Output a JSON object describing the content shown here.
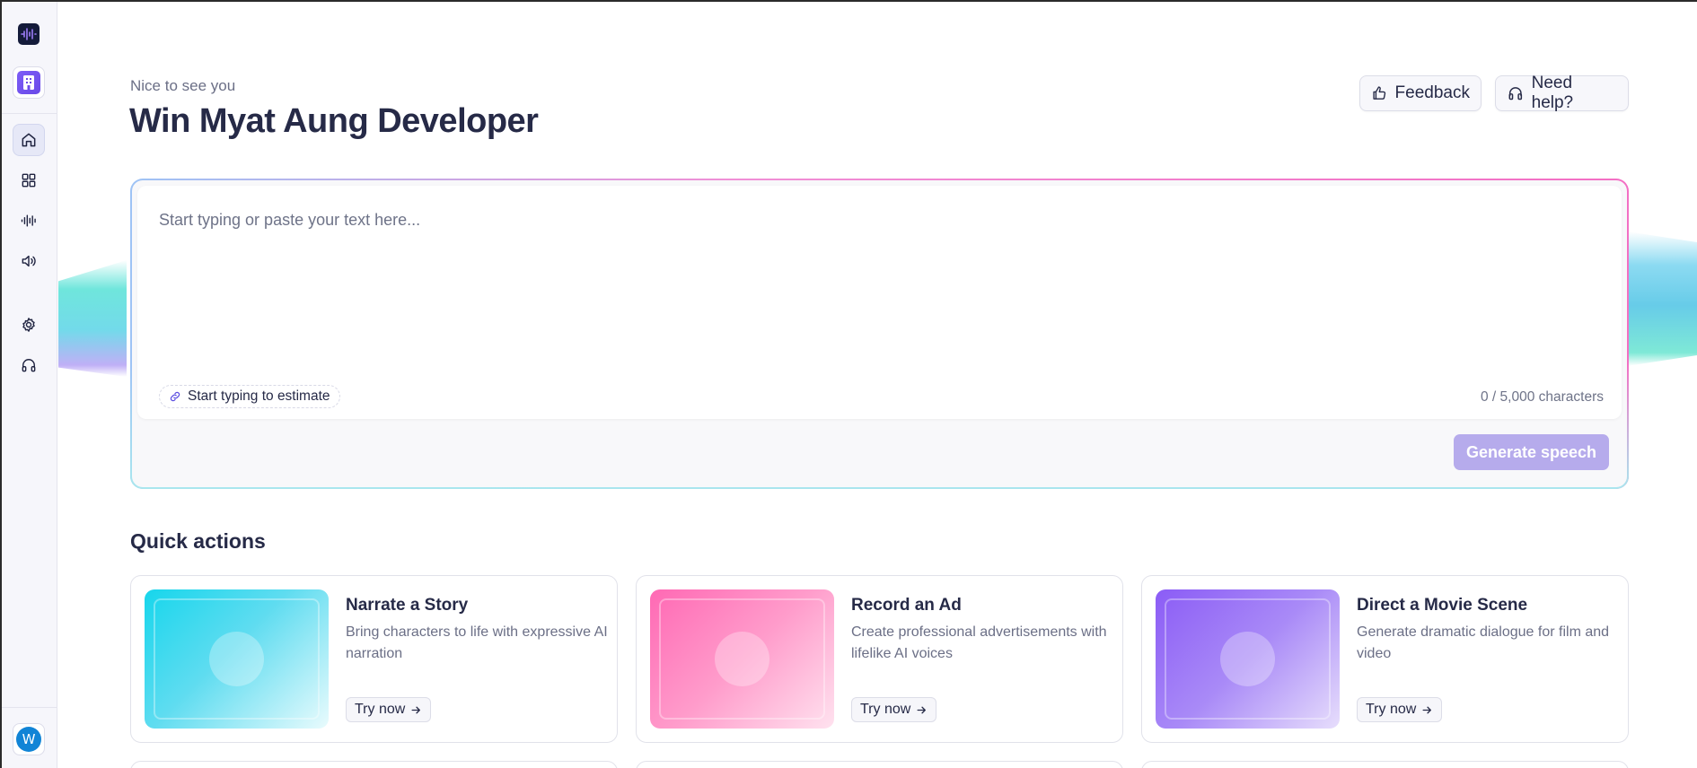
{
  "sidebar": {
    "logo_icon": "waveform-logo-icon",
    "workspace_icon": "building-icon",
    "items": [
      {
        "name": "home",
        "icon": "home-icon"
      },
      {
        "name": "apps",
        "icon": "grid-icon"
      },
      {
        "name": "voices",
        "icon": "waveform-icon"
      },
      {
        "name": "sound",
        "icon": "speaker-icon"
      },
      {
        "name": "settings",
        "icon": "gear-icon"
      },
      {
        "name": "support",
        "icon": "headphones-icon"
      }
    ],
    "avatar_initial": "W"
  },
  "header": {
    "greeting": "Nice to see you",
    "title": "Win Myat Aung Developer",
    "feedback_label": "Feedback",
    "help_label": "Need help?"
  },
  "editor": {
    "placeholder": "Start typing or paste your text here...",
    "estimate_label": "Start typing to estimate",
    "char_count": "0 / 5,000 characters",
    "generate_label": "Generate speech"
  },
  "quick_actions": {
    "title": "Quick actions",
    "cards": [
      {
        "name": "Narrate a Story",
        "desc": "Bring characters to life with expressive AI narration",
        "cta": "Try now",
        "color": "#17d6ec"
      },
      {
        "name": "Record an Ad",
        "desc": "Create professional advertisements with lifelike AI voices",
        "cta": "Try now",
        "color": "#ff69b4"
      },
      {
        "name": "Direct a Movie Scene",
        "desc": "Generate dramatic dialogue for film and video",
        "cta": "Try now",
        "color": "#8b5cf6"
      }
    ]
  },
  "colors": {
    "accent": "#7c5cf6",
    "generate_disabled": "#b6abec",
    "avatar": "#1184d6"
  }
}
